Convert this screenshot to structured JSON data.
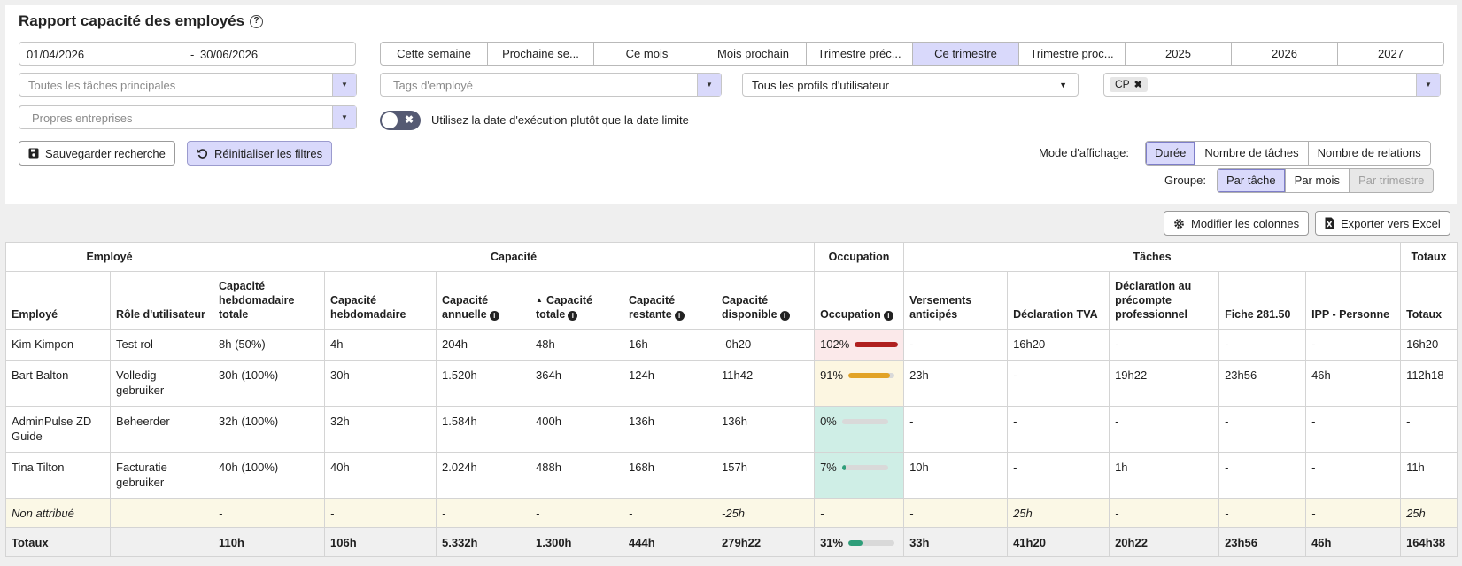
{
  "title": "Rapport capacité des employés",
  "date_from": "01/04/2026",
  "date_sep": "-",
  "date_to": "30/06/2026",
  "periods": [
    {
      "label": "Cette semaine",
      "active": false
    },
    {
      "label": "Prochaine se...",
      "active": false
    },
    {
      "label": "Ce mois",
      "active": false
    },
    {
      "label": "Mois prochain",
      "active": false
    },
    {
      "label": "Trimestre préc...",
      "active": false
    },
    {
      "label": "Ce trimestre",
      "active": true
    },
    {
      "label": "Trimestre proc...",
      "active": false
    },
    {
      "label": "2025",
      "active": false
    },
    {
      "label": "2026",
      "active": false
    },
    {
      "label": "2027",
      "active": false
    }
  ],
  "filters": {
    "main_tasks_placeholder": "Toutes les tâches principales",
    "employee_tags_placeholder": "Tags d'employé",
    "user_profiles_value": "Tous les profils d'utilisateur",
    "chip_label": "CP",
    "own_companies_placeholder": "Propres entreprises",
    "toggle_label": "Utilisez la date d'exécution plutôt que la date limite"
  },
  "buttons": {
    "save_search": "Sauvegarder recherche",
    "reset_filters": "Réinitialiser les filtres",
    "modify_columns": "Modifier les colonnes",
    "export_excel": "Exporter vers Excel"
  },
  "display_mode": {
    "label": "Mode d'affichage:",
    "options": [
      {
        "label": "Durée",
        "active": true
      },
      {
        "label": "Nombre de tâches",
        "active": false
      },
      {
        "label": "Nombre de relations",
        "active": false
      }
    ]
  },
  "group": {
    "label": "Groupe:",
    "options": [
      {
        "label": "Par tâche",
        "state": "on"
      },
      {
        "label": "Par mois",
        "state": "off"
      },
      {
        "label": "Par trimestre",
        "state": "disabled"
      }
    ]
  },
  "table": {
    "groups": {
      "employee": "Employé",
      "capacity": "Capacité",
      "occupation": "Occupation",
      "tasks": "Tâches",
      "totals": "Totaux"
    },
    "columns": {
      "employee": "Employé",
      "role": "Rôle d'utilisateur",
      "weekly_total": "Capacité hebdomadaire totale",
      "weekly": "Capacité hebdomadaire",
      "annual": "Capacité annuelle",
      "total": "Capacité totale",
      "remaining": "Capacité restante",
      "available": "Capacité disponible",
      "occupation": "Occupation",
      "vat_advance": "Versements anticipés",
      "vat_decl": "Déclaration TVA",
      "withholding": "Déclaration au précompte professionnel",
      "fiche": "Fiche 281.50",
      "ipp": "IPP - Personne",
      "totals": "Totaux"
    },
    "rows": [
      {
        "employee": "Kim Kimpon",
        "role": "Test rol",
        "weekly_total": "8h (50%)",
        "weekly": "4h",
        "annual": "204h",
        "total": "48h",
        "remaining": "16h",
        "available": "-0h20",
        "occ_label": "102%",
        "occ_pct": 102,
        "occ_color": "#b0201f",
        "vat_advance": "-",
        "vat_decl": "16h20",
        "withholding": "-",
        "fiche": "-",
        "ipp": "-",
        "totals": "16h20"
      },
      {
        "employee": "Bart Balton",
        "role": "Volledig gebruiker",
        "weekly_total": "30h (100%)",
        "weekly": "30h",
        "annual": "1.520h",
        "total": "364h",
        "remaining": "124h",
        "available": "11h42",
        "occ_label": "91%",
        "occ_pct": 91,
        "occ_color": "#e2a326",
        "vat_advance": "23h",
        "vat_decl": "-",
        "withholding": "19h22",
        "fiche": "23h56",
        "ipp": "46h",
        "totals": "112h18"
      },
      {
        "employee": "AdminPulse ZD Guide",
        "role": "Beheerder",
        "weekly_total": "32h (100%)",
        "weekly": "32h",
        "annual": "1.584h",
        "total": "400h",
        "remaining": "136h",
        "available": "136h",
        "occ_label": "0%",
        "occ_pct": 0,
        "occ_color": "#2f9e7a",
        "vat_advance": "-",
        "vat_decl": "-",
        "withholding": "-",
        "fiche": "-",
        "ipp": "-",
        "totals": "-"
      },
      {
        "employee": "Tina Tilton",
        "role": "Facturatie gebruiker",
        "weekly_total": "40h (100%)",
        "weekly": "40h",
        "annual": "2.024h",
        "total": "488h",
        "remaining": "168h",
        "available": "157h",
        "occ_label": "7%",
        "occ_pct": 7,
        "occ_color": "#2f9e7a",
        "vat_advance": "10h",
        "vat_decl": "-",
        "withholding": "1h",
        "fiche": "-",
        "ipp": "-",
        "totals": "11h"
      }
    ],
    "unassigned": {
      "employee": "Non attribué",
      "role": "",
      "weekly_total": "-",
      "weekly": "-",
      "annual": "-",
      "total": "-",
      "remaining": "-",
      "available": "-25h",
      "occupation": "-",
      "vat_advance": "-",
      "vat_decl": "25h",
      "withholding": "-",
      "fiche": "-",
      "ipp": "-",
      "totals": "25h"
    },
    "totals": {
      "employee": "Totaux",
      "role": "",
      "weekly_total": "110h",
      "weekly": "106h",
      "annual": "5.332h",
      "total": "1.300h",
      "remaining": "444h",
      "available": "279h22",
      "occ_label": "31%",
      "occ_pct": 31,
      "occ_color": "#2f9e7a",
      "vat_advance": "33h",
      "vat_decl": "41h20",
      "withholding": "20h22",
      "fiche": "23h56",
      "ipp": "46h",
      "totals": "164h38"
    }
  },
  "colors": {
    "accent": "#d9d9fb",
    "toggle": "#555a73",
    "occ_red_bg": "#fbe9ea",
    "occ_yellow_bg": "#fcf6e1",
    "occ_green_bg": "#cfeee6"
  },
  "icons": {
    "help": "help-circle-icon",
    "save": "floppy-disk-icon",
    "reset": "undo-icon",
    "columns": "gear-icon",
    "excel": "excel-file-icon",
    "info": "info-icon"
  }
}
